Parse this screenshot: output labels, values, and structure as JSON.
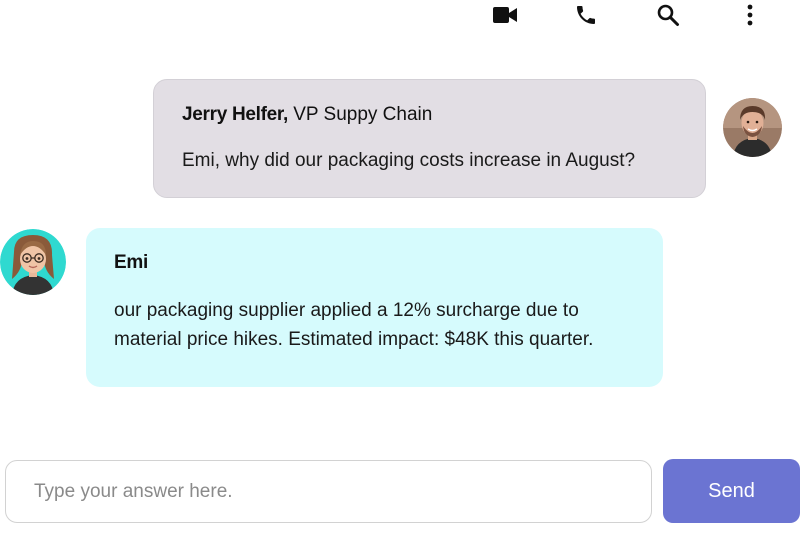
{
  "toolbar": {
    "icons": [
      "video-camera-icon",
      "phone-icon",
      "search-icon",
      "more-vertical-icon"
    ]
  },
  "messages": [
    {
      "sender_name": "Jerry Helfer,",
      "sender_role": " VP Suppy Chain",
      "text": "Emi, why did our packaging costs increase in August?",
      "bubble_color": "#e2dee4"
    },
    {
      "sender_name": "Emi",
      "text": "our packaging supplier applied a 12% surcharge due to material price hikes. Estimated impact: $48K this quarter.",
      "bubble_color": "#d6fbfd"
    }
  ],
  "composer": {
    "placeholder": "Type your answer here.",
    "value": "",
    "send_label": "Send",
    "send_color": "#6b74d2"
  }
}
